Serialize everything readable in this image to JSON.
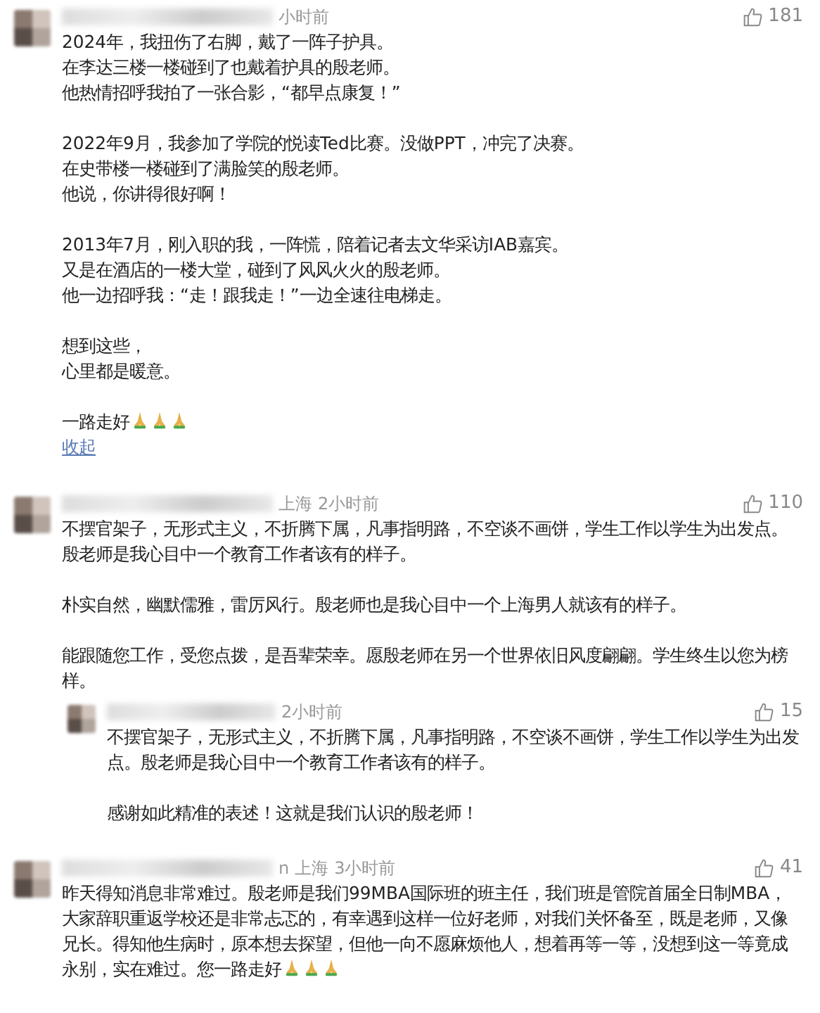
{
  "comments": [
    {
      "time": "小时前",
      "likes": "181",
      "paragraphs": [
        {
          "lines": [
            "2024年，我扭伤了右脚，戴了一阵子护具。",
            "在李达三楼一楼碰到了也戴着护具的殷老师。",
            "他热情招呼我拍了一张合影，“都早点康复！”"
          ]
        },
        {
          "lines": [
            "2022年9月，我参加了学院的悦读Ted比赛。没做PPT，冲完了决赛。",
            "在史带楼一楼碰到了满脸笑的殷老师。",
            "他说，你讲得很好啊！"
          ]
        },
        {
          "lines": [
            "2013年7月，刚入职的我，一阵慌，陪着记者去文华采访IAB嘉宾。",
            "又是在酒店的一楼大堂，碰到了风风火火的殷老师。",
            "他一边招呼我：“走！跟我走！”一边全速往电梯走。"
          ]
        },
        {
          "lines": [
            "想到这些，",
            "心里都是暖意。"
          ]
        },
        {
          "lines": [
            "一路走好"
          ],
          "icons": [
            {
              "kind": "pray"
            },
            {
              "kind": "pray"
            },
            {
              "kind": "pray"
            }
          ]
        }
      ],
      "collapse": "收起"
    },
    {
      "location": "上海",
      "time": "2小时前",
      "likes": "110",
      "paragraphs": [
        {
          "lines": [
            "不摆官架子，无形式主义，不折腾下属，凡事指明路，不空谈不画饼，学生工作以学生为出发点。殷老师是我心目中一个教育工作者该有的样子。"
          ]
        },
        {
          "lines": [
            "朴实自然，幽默儒雅，雷厉风行。殷老师也是我心目中一个上海男人就该有的样子。"
          ]
        },
        {
          "lines": [
            "能跟随您工作，受您点拨，是吾辈荣幸。愿殷老师在另一个世界依旧风度翩翩。学生终生以您为榜样。"
          ]
        }
      ],
      "replies": [
        {
          "time": "2小时前",
          "likes": "15",
          "paragraphs": [
            {
              "lines": [
                "不摆官架子，无形式主义，不折腾下属，凡事指明路，不空谈不画饼，学生工作以学生为出发点。殷老师是我心目中一个教育工作者该有的样子。"
              ]
            },
            {
              "lines": [
                "感谢如此精准的表述！这就是我们认识的殷老师！"
              ]
            }
          ]
        }
      ]
    },
    {
      "name_tail": "n",
      "location": "上海",
      "time": "3小时前",
      "likes": "41",
      "paragraphs": [
        {
          "lines": [
            "昨天得知消息非常难过。殷老师是我们99MBA国际班的班主任，我们班是管院首届全日制MBA，大家辞职重返学校还是非常忐忑的，有幸遇到这样一位好老师，对我们关怀备至，既是老师，又像兄长。得知他生病时，原本想去探望，但他一向不愿麻烦他人，想着再等一等，没想到这一等竟成永别，实在难过。您一路走好"
          ],
          "icons": [
            {
              "kind": "pray"
            },
            {
              "kind": "pray"
            },
            {
              "kind": "pray"
            }
          ]
        }
      ]
    }
  ]
}
